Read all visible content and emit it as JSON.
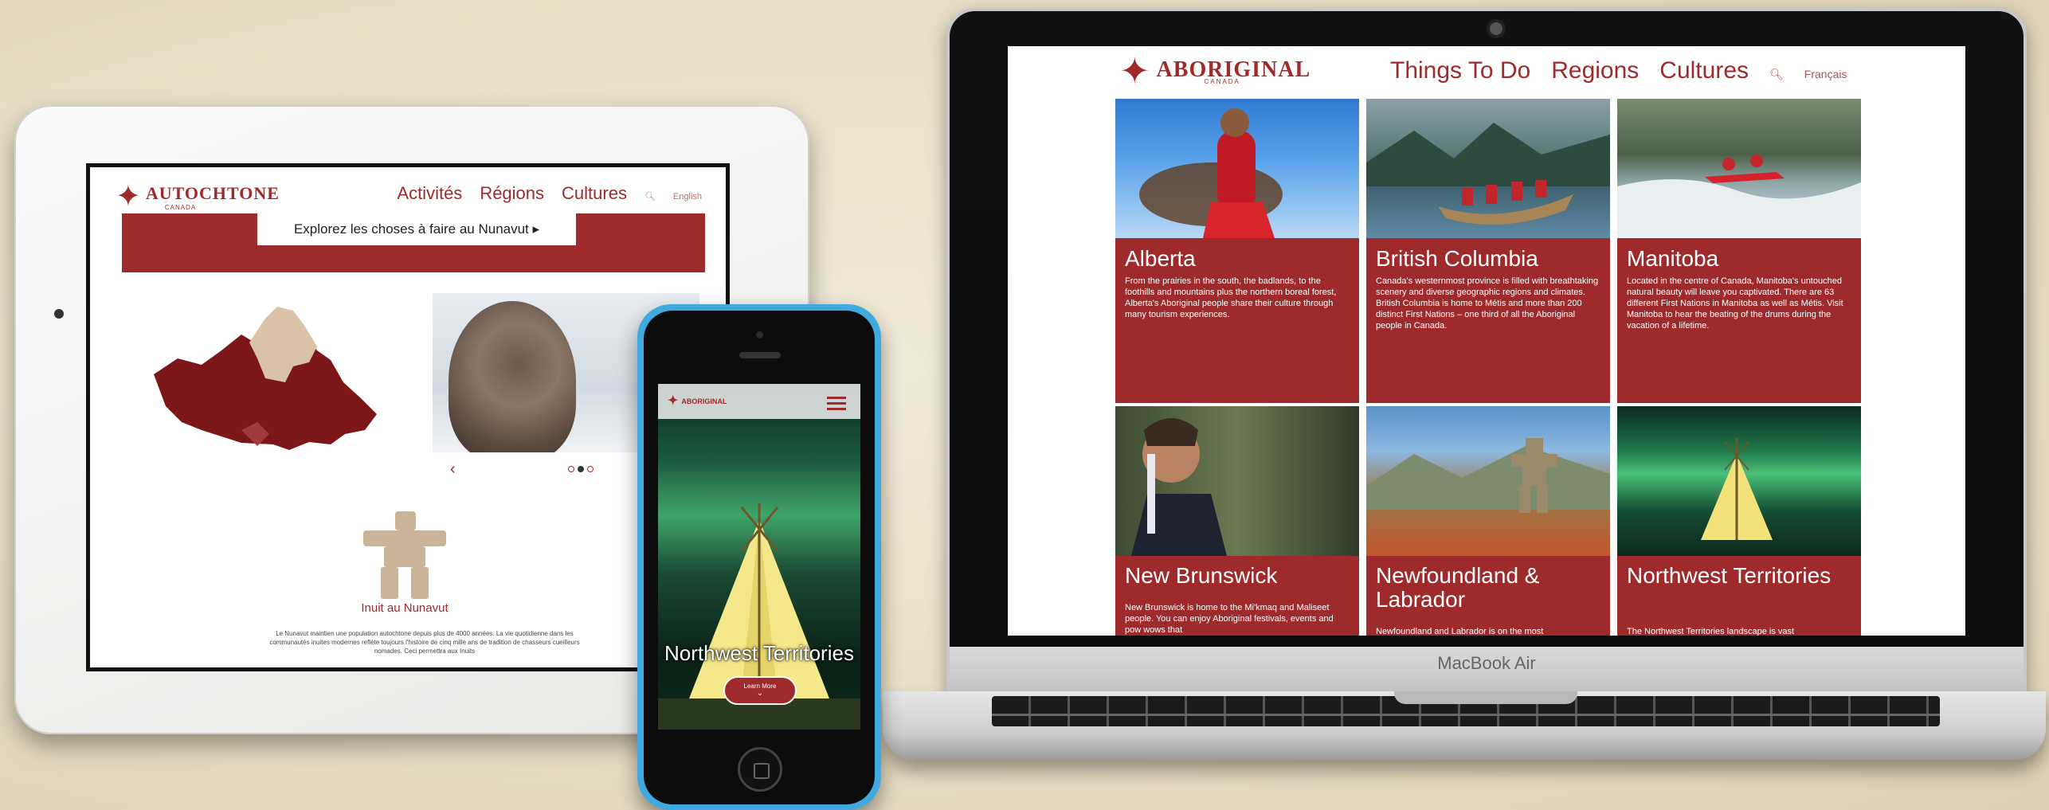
{
  "tablet": {
    "logo": "AUTOCHTONE",
    "logo_sub": "CANADA",
    "nav": [
      "Activités",
      "Régions",
      "Cultures"
    ],
    "language": "English",
    "banner": "Explorez les choses à faire au Nunavut ▸",
    "carousel_prev": "‹",
    "inuksuk_title": "Inuit au Nunavut",
    "description": "Le Nunavut maintien une population autochtone depuis plus de 4000 années. La vie quotidienne dans les communautés inuites modernes reflète toujours l'histoire de cinq mille ans de tradition de chasseurs cueilleurs nomades. Ceci permettra aux Inuits"
  },
  "phone": {
    "logo": "ABORIGINAL",
    "hero_title": "Northwest Territories",
    "button": "Learn More",
    "button_chevron": "⌄"
  },
  "laptop": {
    "logo": "ABORIGINAL",
    "logo_sub": "CANADA",
    "nav": [
      "Things To Do",
      "Regions",
      "Cultures"
    ],
    "language": "Français",
    "brand_label": "MacBook Air",
    "cards": [
      {
        "name": "Alberta",
        "text": "From the prairies in the south, the badlands, to the foothills and mountains plus the northern boreal forest, Alberta's Aboriginal people share their culture through many tourism experiences."
      },
      {
        "name": "British Columbia",
        "text": "Canada's westernmost province is filled with breathtaking scenery and diverse geographic regions and climates. British Columbia is home to Métis and more than 200 distinct First Nations – one third of all the Aboriginal people in Canada."
      },
      {
        "name": "Manitoba",
        "text": "Located in the centre of Canada, Manitoba's untouched natural beauty will leave you captivated. There are 63 different First Nations in Manitoba as well as Métis. Visit Manitoba to hear the beating of the drums during the vacation of a lifetime."
      },
      {
        "name": "New Brunswick",
        "text": "New Brunswick is home to the Mi'kmaq and Maliseet people. You can enjoy Aboriginal festivals, events and pow wows that"
      },
      {
        "name": "Newfoundland & Labrador",
        "text": "Newfoundland and Labrador is on the most"
      },
      {
        "name": "Northwest Territories",
        "text": "The Northwest Territories landscape is vast"
      }
    ]
  },
  "colors": {
    "brand_red": "#9e2a2b",
    "phone_case": "#3fa9e0",
    "background": "#ece3cf"
  }
}
